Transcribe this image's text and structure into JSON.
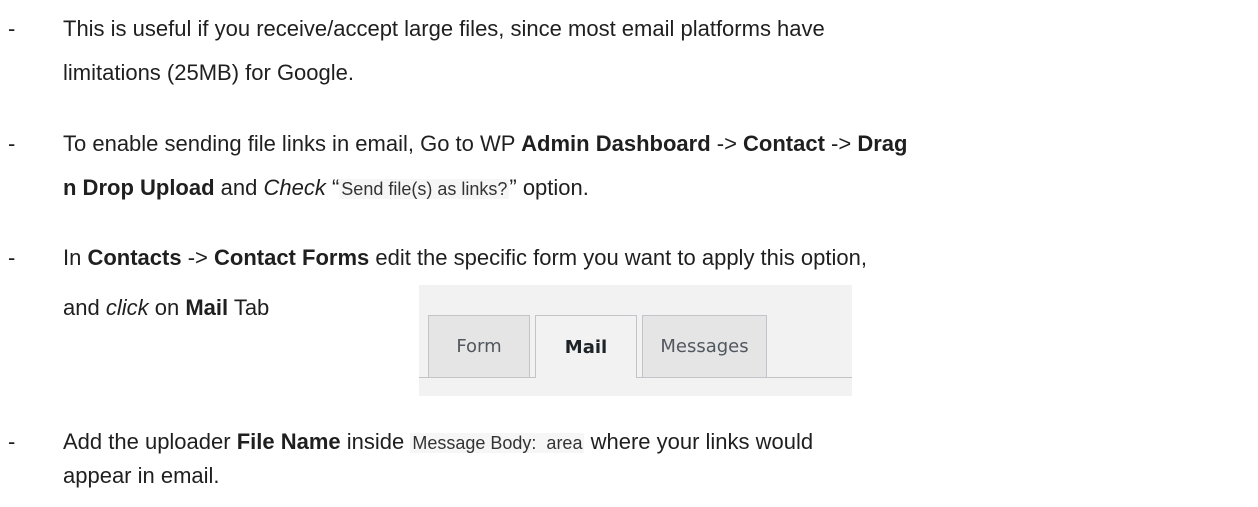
{
  "bullet": "-",
  "item1": {
    "line1": "This is useful if you receive/accept large files, since most email platforms have",
    "line2": "limitations (25MB) for Google."
  },
  "item2": {
    "t1": "To enable sending file links in email, Go to WP ",
    "b1": "Admin Dashboard",
    "t2": " -> ",
    "b2": "Contact",
    "t3": " -> ",
    "b3": "Drag",
    "b4": "n Drop Upload",
    "t4": " and ",
    "i1": "Check",
    "t5": " “",
    "code": "Send file(s) as links?",
    "t6": "” option."
  },
  "item3": {
    "t1": "In ",
    "b1": "Contacts",
    "t2": " -> ",
    "b2": "Contact Forms",
    "t3": "  edit the specific form you want to apply this option,",
    "t4": "and ",
    "i1": "click",
    "t5": " on ",
    "b3": "Mail",
    "t6": " Tab",
    "tabs": [
      "Form",
      "Mail",
      "Messages"
    ],
    "active_tab": "Mail"
  },
  "item4": {
    "t1": "Add the uploader ",
    "b1": "File Name",
    "t2": " inside ",
    "code": "Message Body:  area",
    "t3": " where your links would",
    "line2": "appear in email."
  }
}
